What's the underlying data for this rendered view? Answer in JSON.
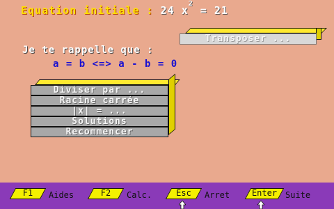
{
  "equation": {
    "label": "Equation initiale : ",
    "coef": "24 x",
    "exponent": "2",
    "rhs": " = 21"
  },
  "transpose_button": "Transposer ...",
  "reminder": {
    "intro": "Je te rappelle que :",
    "formula": "a = b <=> a - b = 0"
  },
  "menu": {
    "items": [
      "Diviser par ...",
      "Racine carrée",
      "|x| = ...",
      "Solutions",
      "Recommencer"
    ]
  },
  "function_bar": {
    "keys": [
      {
        "key": "F1",
        "label": "Aides"
      },
      {
        "key": "F2",
        "label": "Calc."
      },
      {
        "key": "Esc",
        "label": "Arret"
      },
      {
        "key": "Enter",
        "label": "Suite"
      }
    ]
  },
  "colors": {
    "background": "#E9A98E",
    "bar": "#8A3AB8",
    "key": "#F4F000",
    "formula": "#1A10D0",
    "title": "#FFE000"
  }
}
